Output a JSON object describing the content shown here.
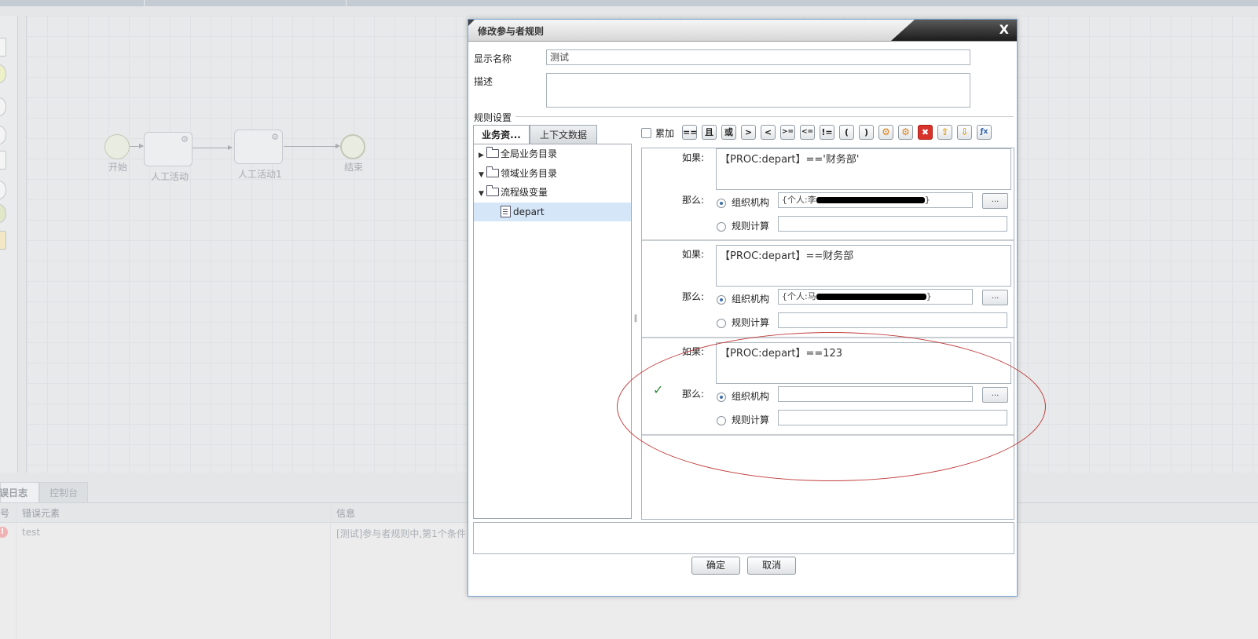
{
  "background": {
    "nodes": {
      "start": "开始",
      "task1": "人工活动",
      "task2": "人工活动1",
      "end": "结束"
    },
    "bottom": {
      "tabs": [
        "误日志",
        "控制台"
      ],
      "columns": [
        "号",
        "错误元素",
        "信息"
      ],
      "row": {
        "element": "test",
        "message": "[测试]参与者规则中,第1个条件"
      }
    }
  },
  "dialog": {
    "title": "修改参与者规则",
    "close": "X",
    "display_name_label": "显示名称",
    "display_name_value": "测试",
    "description_label": "描述",
    "description_value": "",
    "rules_section_label": "规则设置",
    "tabs": [
      "业务资...",
      "上下文数据"
    ],
    "tree": [
      {
        "label": "全局业务目录",
        "expanded": false
      },
      {
        "label": "领域业务目录",
        "expanded": true
      },
      {
        "label": "流程级变量",
        "expanded": true
      },
      {
        "label": "depart",
        "leaf": true
      }
    ],
    "toolbar": {
      "accumulate_label": "累加",
      "ops": [
        "==",
        "且",
        "或",
        ">",
        "<",
        ">=",
        "<=",
        "!=",
        "(",
        ")"
      ]
    },
    "rules": [
      {
        "if_label": "如果:",
        "condition": "【PROC:depart】=='财务部'",
        "then_label": "那么:",
        "org_label": "组织机构",
        "org_value": "{个人:李",
        "calc_label": "规则计算",
        "calc_value": "",
        "dots": "..."
      },
      {
        "if_label": "如果:",
        "condition": "【PROC:depart】==财务部",
        "then_label": "那么:",
        "org_label": "组织机构",
        "org_value": "{个人:马",
        "calc_label": "规则计算",
        "calc_value": "",
        "dots": "..."
      },
      {
        "if_label": "如果:",
        "condition": "【PROC:depart】==123",
        "then_label": "那么:",
        "org_label": "组织机构",
        "org_value": "",
        "calc_label": "规则计算",
        "calc_value": "",
        "dots": "..."
      }
    ],
    "ok_label": "确定",
    "cancel_label": "取消"
  }
}
